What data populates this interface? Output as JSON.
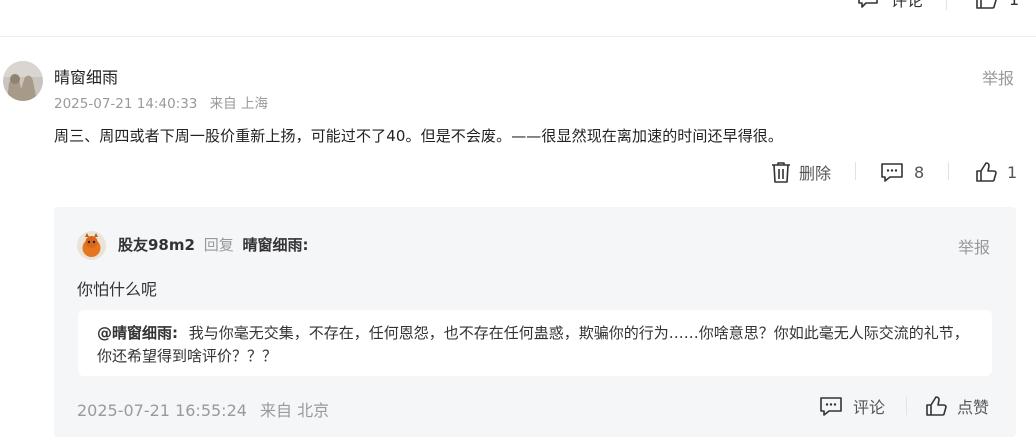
{
  "top_actions": {
    "comment_label": "评论",
    "like_count": "1"
  },
  "comment": {
    "username": "晴窗细雨",
    "timestamp": "2025-07-21 14:40:33",
    "location": "来自 上海",
    "report_label": "举报",
    "body": "周三、周四或者下周一股价重新上扬，可能过不了40。但是不会废。——很显然现在离加速的时间还早得很。",
    "actions": {
      "delete_label": "删除",
      "reply_count": "8",
      "like_count": "1"
    }
  },
  "reply": {
    "username": "股友98m2",
    "reply_word": "回复",
    "target_user": "晴窗细雨:",
    "report_label": "举报",
    "body": "你怕什么呢",
    "quoted": {
      "mention": "@晴窗细雨:",
      "text": "我与你毫无交集，不存在，任何恩怨，也不存在任何蛊惑，欺骗你的行为……你啥意思？你如此毫无人际交流的礼节，你还希望得到啥评价？？？"
    },
    "timestamp": "2025-07-21 16:55:24",
    "location": "来自 北京",
    "actions": {
      "comment_label": "评论",
      "like_label": "点赞"
    }
  }
}
